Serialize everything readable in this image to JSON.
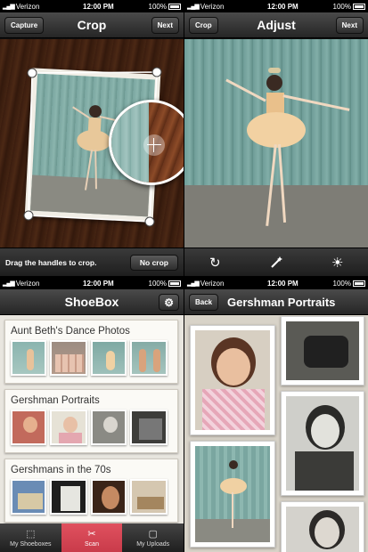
{
  "status": {
    "carrier": "Verizon",
    "time": "12:00 PM",
    "battery": "100%"
  },
  "crop_screen": {
    "title": "Crop",
    "left_button": "Capture",
    "right_button": "Next",
    "hint": "Drag the handles to crop.",
    "no_crop_button": "No crop"
  },
  "adjust_screen": {
    "title": "Adjust",
    "left_button": "Crop",
    "right_button": "Next",
    "tools": [
      "rotate-icon",
      "magic-wand-icon",
      "brightness-icon"
    ]
  },
  "shoebox_screen": {
    "title": "ShoeBox",
    "shelves": [
      {
        "title": "Aunt Beth's Dance Photos"
      },
      {
        "title": "Gershman Portraits"
      },
      {
        "title": "Gershmans in the 70s"
      }
    ],
    "tabs": [
      {
        "label": "My Shoeboxes",
        "icon": "box-icon"
      },
      {
        "label": "Scan",
        "icon": "scissors-icon"
      },
      {
        "label": "My Uploads",
        "icon": "frame-icon"
      }
    ]
  },
  "album_screen": {
    "back_button": "Back",
    "title": "Gershman Portraits"
  },
  "colors": {
    "accent": "#d24452",
    "navbar": "#2f2f2f",
    "wood": "#7a3f22",
    "curtain": "#6f9d98"
  }
}
